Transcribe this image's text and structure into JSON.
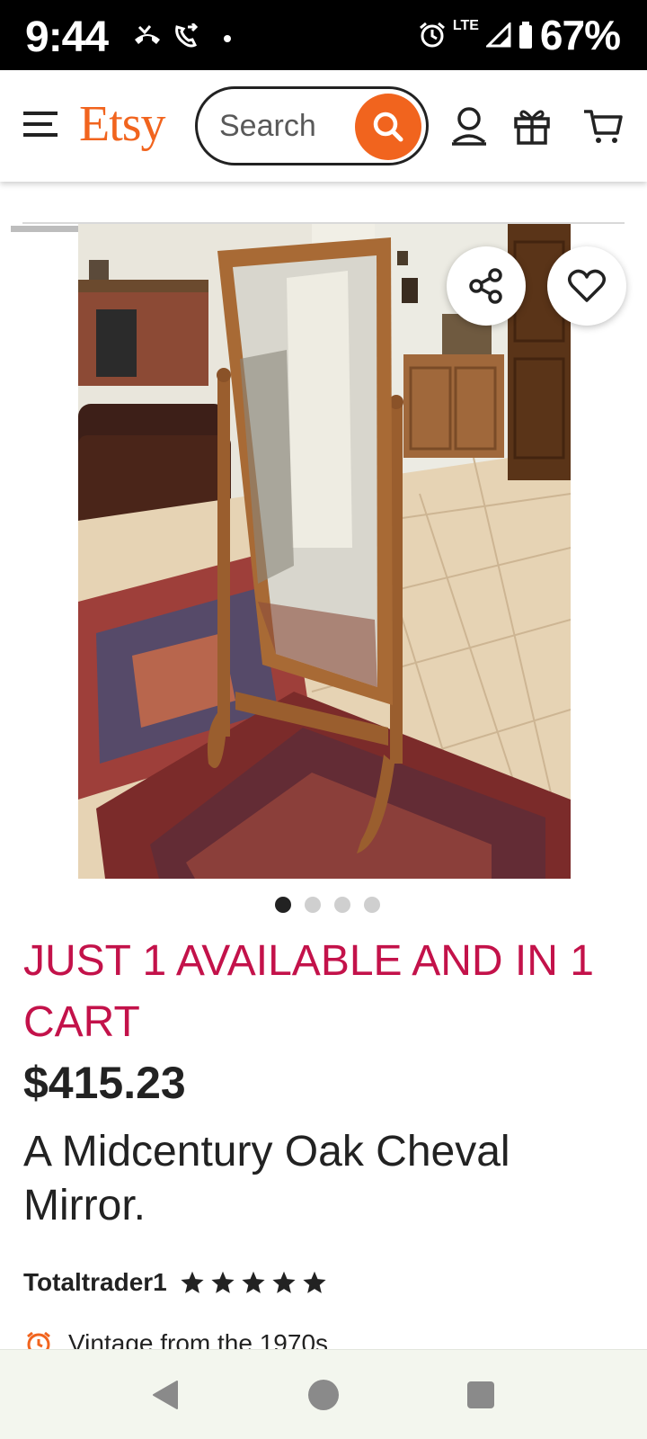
{
  "status_bar": {
    "time": "9:44",
    "network": "LTE",
    "battery": "67%"
  },
  "header": {
    "logo": "Etsy",
    "search_placeholder": "Search",
    "accent_color": "#f1641e",
    "icons": [
      "menu-icon",
      "search-icon",
      "account-icon",
      "gift-icon",
      "cart-icon"
    ]
  },
  "gallery": {
    "image_count": 4,
    "active_index": 0,
    "actions": [
      "share-icon",
      "heart-icon"
    ]
  },
  "listing": {
    "availability": "JUST 1 AVAILABLE AND IN 1 CART",
    "availability_color": "#c3124a",
    "price": "$415.23",
    "title": "A Midcentury Oak Cheval Mirror.",
    "shop_name": "Totaltrader1",
    "rating": 5,
    "vintage_note": "Vintage from the 1970s"
  },
  "nav_bar": {
    "buttons": [
      "back-icon",
      "home-icon",
      "recents-icon"
    ]
  }
}
